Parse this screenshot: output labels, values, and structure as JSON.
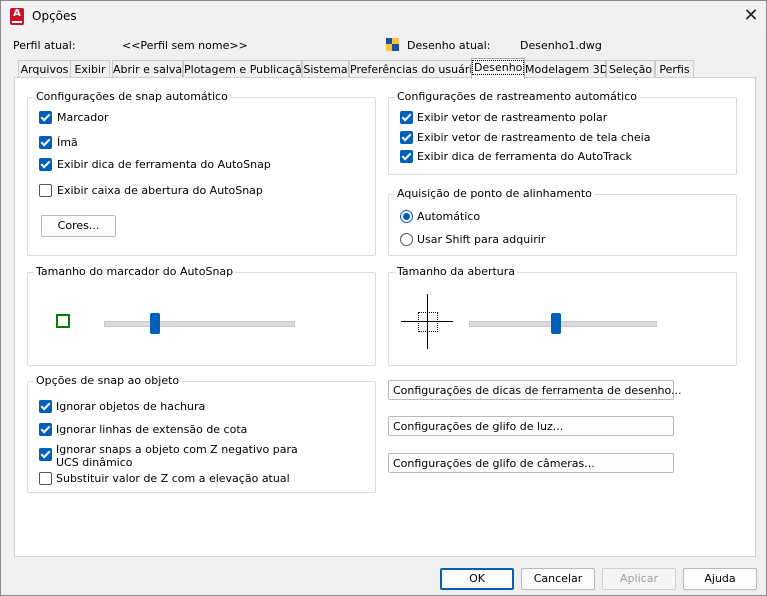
{
  "window": {
    "title": "Opções"
  },
  "profile": {
    "label": "Perfil atual:",
    "value": "<<Perfil sem nome>>"
  },
  "drawing": {
    "label": "Desenho atual:",
    "value": "Desenho1.dwg"
  },
  "tabs": [
    {
      "label": "Arquivos"
    },
    {
      "label": "Exibir"
    },
    {
      "label": "Abrir e salvar"
    },
    {
      "label": "Plotagem e Publicação"
    },
    {
      "label": "Sistema"
    },
    {
      "label": "Preferências do usuário"
    },
    {
      "label": "Desenho"
    },
    {
      "label": "Modelagem 3D"
    },
    {
      "label": "Seleção"
    },
    {
      "label": "Perfis"
    }
  ],
  "autosnap": {
    "title": "Configurações de snap automático",
    "marker": {
      "label": "Marcador",
      "checked": true
    },
    "magnet": {
      "label": "Ímã",
      "checked": true
    },
    "tooltip": {
      "label": "Exibir dica de ferramenta do AutoSnap",
      "checked": true
    },
    "aperture": {
      "label": "Exibir caixa de abertura do AutoSnap",
      "checked": false
    },
    "colors_button": "Cores..."
  },
  "autotrack": {
    "title": "Configurações de rastreamento automático",
    "polar": {
      "label": "Exibir vetor de rastreamento polar",
      "checked": true
    },
    "fullscreen": {
      "label": "Exibir vetor de rastreamento de tela cheia",
      "checked": true
    },
    "tooltip": {
      "label": "Exibir dica de ferramenta do AutoTrack",
      "checked": true
    }
  },
  "alignment": {
    "title": "Aquisição de ponto de alinhamento",
    "automatic": {
      "label": "Automático",
      "selected": true
    },
    "shift": {
      "label": "Usar Shift para adquirir",
      "selected": false
    }
  },
  "marker_size": {
    "title": "Tamanho do marcador do AutoSnap",
    "level": 0.27,
    "marker_color": "#008000"
  },
  "aperture_size": {
    "title": "Tamanho da abertura",
    "level": 0.47
  },
  "osnap": {
    "title": "Opções de snap ao objeto",
    "hatch": {
      "label": "Ignorar objetos de hachura",
      "checked": true
    },
    "dimext": {
      "label": "Ignorar linhas de extensão de cota",
      "checked": true
    },
    "negz": {
      "label": "Ignorar snaps a objeto com Z negativo para UCS dinâmico",
      "checked": true
    },
    "replacez": {
      "label": "Substituir valor de Z com a elevação atual",
      "checked": false
    }
  },
  "buttons": {
    "draft_tooltip": "Configurações de dicas de ferramenta de desenho...",
    "light_glyph": "Configurações de glifo de luz...",
    "camera_glyph": "Configurações de glifo de câmeras...",
    "ok": "OK",
    "cancel": "Cancelar",
    "apply": "Aplicar",
    "help": "Ajuda"
  },
  "colors": {
    "accent": "#005fb8"
  }
}
